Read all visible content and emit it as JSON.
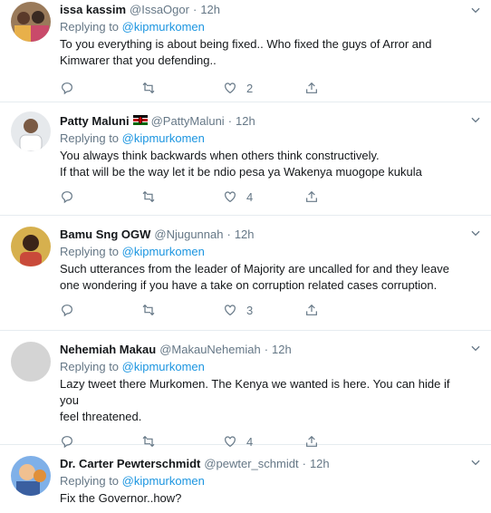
{
  "tweets": [
    {
      "name": "issa kassim",
      "handle": "@IssaOgor",
      "time": "12h",
      "reply_prefix": "Replying to ",
      "reply_to": "@kipmurkomen",
      "lines": [
        "To you everything is about being fixed.. Who fixed the guys of Arror and",
        "Kimwarer that you defending.."
      ],
      "likes": "2",
      "avatar": {
        "bg": "#8a6a4a",
        "accent": "#e8b04a"
      },
      "flag": false
    },
    {
      "name": "Patty Maluni",
      "handle": "@PattyMaluni",
      "time": "12h",
      "reply_prefix": "Replying to ",
      "reply_to": "@kipmurkomen",
      "lines": [
        "You always think backwards when others think constructively.",
        "If that will be the way let it be ndio pesa ya Wakenya muogope kukula"
      ],
      "likes": "4",
      "avatar": {
        "bg": "#d9dde2",
        "accent": "#6b5b4b"
      },
      "flag": true
    },
    {
      "name": "Bamu Sng OGW",
      "handle": "@Njugunnah",
      "time": "12h",
      "reply_prefix": "Replying to ",
      "reply_to": "@kipmurkomen",
      "lines": [
        "Such utterances from the leader of Majority are uncalled for and they leave",
        "one wondering if you have a take on corruption related cases corruption."
      ],
      "likes": "3",
      "avatar": {
        "bg": "#c9a64a",
        "accent": "#3a2418"
      },
      "flag": false
    },
    {
      "name": "Nehemiah Makau",
      "handle": "@MakauNehemiah",
      "time": "12h",
      "reply_prefix": "Replying to ",
      "reply_to": "@kipmurkomen",
      "lines": [
        "Lazy tweet there Murkomen. The Kenya we wanted is here. You can hide if you",
        "feel threatened."
      ],
      "likes": "4",
      "avatar": {
        "bg": "#d4d4d4",
        "accent": "#d4d4d4"
      },
      "flag": false
    },
    {
      "name": "Dr. Carter Pewterschmidt",
      "handle": "@pewter_schmidt",
      "time": "12h",
      "reply_prefix": "Replying to ",
      "reply_to": "@kipmurkomen",
      "lines": [
        "Fix the Governor..how?"
      ],
      "likes": "",
      "avatar": {
        "bg": "#4a7fc9",
        "accent": "#e0903a"
      },
      "flag": false
    }
  ],
  "colors": {
    "link": "#1b95e0",
    "muted": "#657786",
    "text": "#14171a",
    "border": "#e6ecf0"
  },
  "icons": {
    "reply": "reply-icon",
    "retweet": "retweet-icon",
    "like": "heart-icon",
    "share": "share-icon",
    "menu": "chevron-down-icon"
  }
}
